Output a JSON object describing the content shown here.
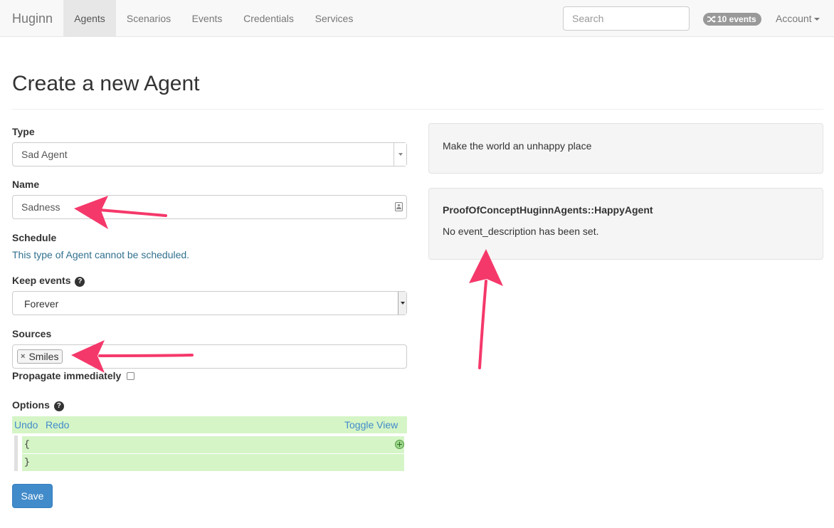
{
  "navbar": {
    "brand": "Huginn",
    "items": [
      {
        "label": "Agents",
        "active": true
      },
      {
        "label": "Scenarios",
        "active": false
      },
      {
        "label": "Events",
        "active": false
      },
      {
        "label": "Credentials",
        "active": false
      },
      {
        "label": "Services",
        "active": false
      }
    ],
    "search_placeholder": "Search",
    "events_badge": "10 events",
    "events_icon": "shuffle-icon",
    "account_label": "Account"
  },
  "page": {
    "title": "Create a new Agent"
  },
  "form": {
    "type": {
      "label": "Type",
      "value": "Sad Agent"
    },
    "name": {
      "label": "Name",
      "value": "Sadness"
    },
    "schedule": {
      "label": "Schedule",
      "note": "This type of Agent cannot be scheduled."
    },
    "keep_events": {
      "label": "Keep events",
      "value": "Forever"
    },
    "sources": {
      "label": "Sources",
      "chips": [
        "Smiles"
      ]
    },
    "propagate": {
      "label": "Propagate immediately",
      "checked": false
    },
    "options": {
      "label": "Options",
      "undo": "Undo",
      "redo": "Redo",
      "toggle": "Toggle View",
      "lines": [
        "{",
        "}"
      ]
    },
    "save_label": "Save"
  },
  "sidebar": {
    "description": "Make the world an unhappy place",
    "agent_class": "ProofOfConceptHuginnAgents::HappyAgent",
    "event_description": "No event_description has been set."
  },
  "colors": {
    "arrow": "#f5386a",
    "editor_bg": "#d5f5c7",
    "primary": "#428bca",
    "link": "#428bca",
    "info_text": "#31708f"
  }
}
